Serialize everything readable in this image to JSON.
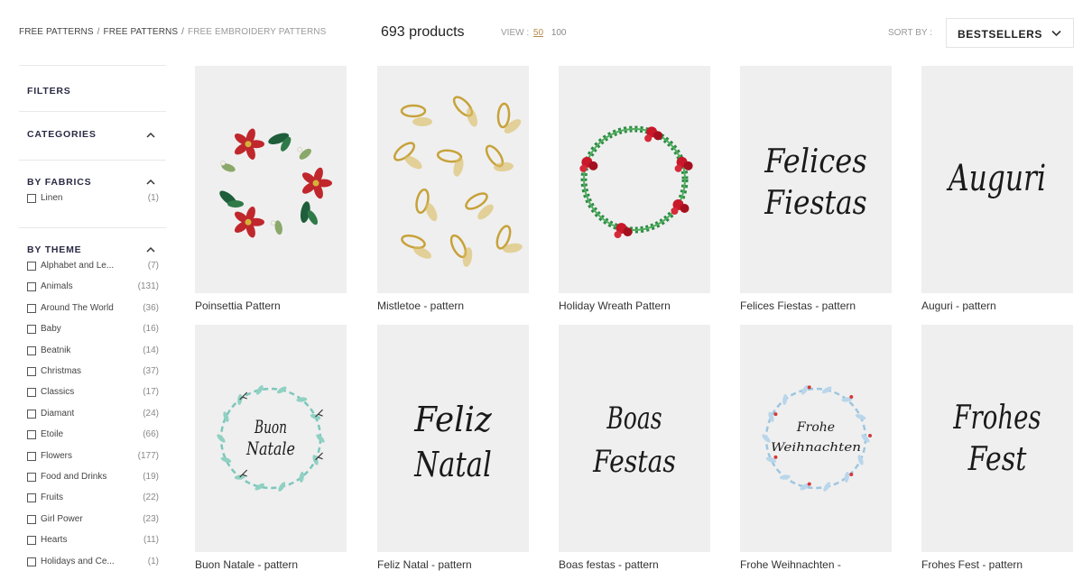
{
  "breadcrumb": [
    "FREE PATTERNS",
    "FREE PATTERNS",
    "FREE EMBROIDERY PATTERNS"
  ],
  "product_count": "693 products",
  "view": {
    "label": "VIEW :",
    "options": [
      "50",
      "100"
    ],
    "selected": "50"
  },
  "sort": {
    "label": "SORT BY :",
    "value": "BESTSELLERS"
  },
  "sidebar": {
    "filters_title": "FILTERS",
    "categories_title": "CATEGORIES",
    "fabrics": {
      "title": "BY FABRICS",
      "items": [
        {
          "label": "Linen",
          "count": "(1)"
        }
      ]
    },
    "theme": {
      "title": "BY THEME",
      "items": [
        {
          "label": "Alphabet and Le...",
          "count": "(7)"
        },
        {
          "label": "Animals",
          "count": "(131)"
        },
        {
          "label": "Around The World",
          "count": "(36)"
        },
        {
          "label": "Baby",
          "count": "(16)"
        },
        {
          "label": "Beatnik",
          "count": "(14)"
        },
        {
          "label": "Christmas",
          "count": "(37)"
        },
        {
          "label": "Classics",
          "count": "(17)"
        },
        {
          "label": "Diamant",
          "count": "(24)"
        },
        {
          "label": "Étoile",
          "count": "(66)"
        },
        {
          "label": "Flowers",
          "count": "(177)"
        },
        {
          "label": "Food and Drinks",
          "count": "(19)"
        },
        {
          "label": "Fruits",
          "count": "(22)"
        },
        {
          "label": "Girl Power",
          "count": "(23)"
        },
        {
          "label": "Hearts",
          "count": "(11)"
        },
        {
          "label": "Holidays and Ce...",
          "count": "(1)"
        }
      ]
    }
  },
  "products": [
    {
      "name": "Poinsettia Pattern"
    },
    {
      "name": "Mistletoe - pattern"
    },
    {
      "name": "Holiday Wreath Pattern"
    },
    {
      "name": "Felices Fiestas - pattern",
      "art": [
        "Felices",
        "Fiestas"
      ]
    },
    {
      "name": "Auguri - pattern",
      "art": [
        "Auguri"
      ]
    },
    {
      "name": "Buon Natale - pattern",
      "art": [
        "Buon",
        "Natale"
      ]
    },
    {
      "name": "Feliz Natal - pattern",
      "art": [
        "Feliz",
        "Natal"
      ]
    },
    {
      "name": "Boas festas - pattern",
      "art": [
        "Boas",
        "Festas"
      ]
    },
    {
      "name": "Frohe Weihnachten -",
      "art": [
        "Frohe",
        "Weihnachten"
      ]
    },
    {
      "name": "Frohes Fest - pattern",
      "art": [
        "Frohes",
        "Fest"
      ]
    }
  ],
  "colors": {
    "accent": "#b58d4c",
    "thumb_bg": "#efefef"
  }
}
